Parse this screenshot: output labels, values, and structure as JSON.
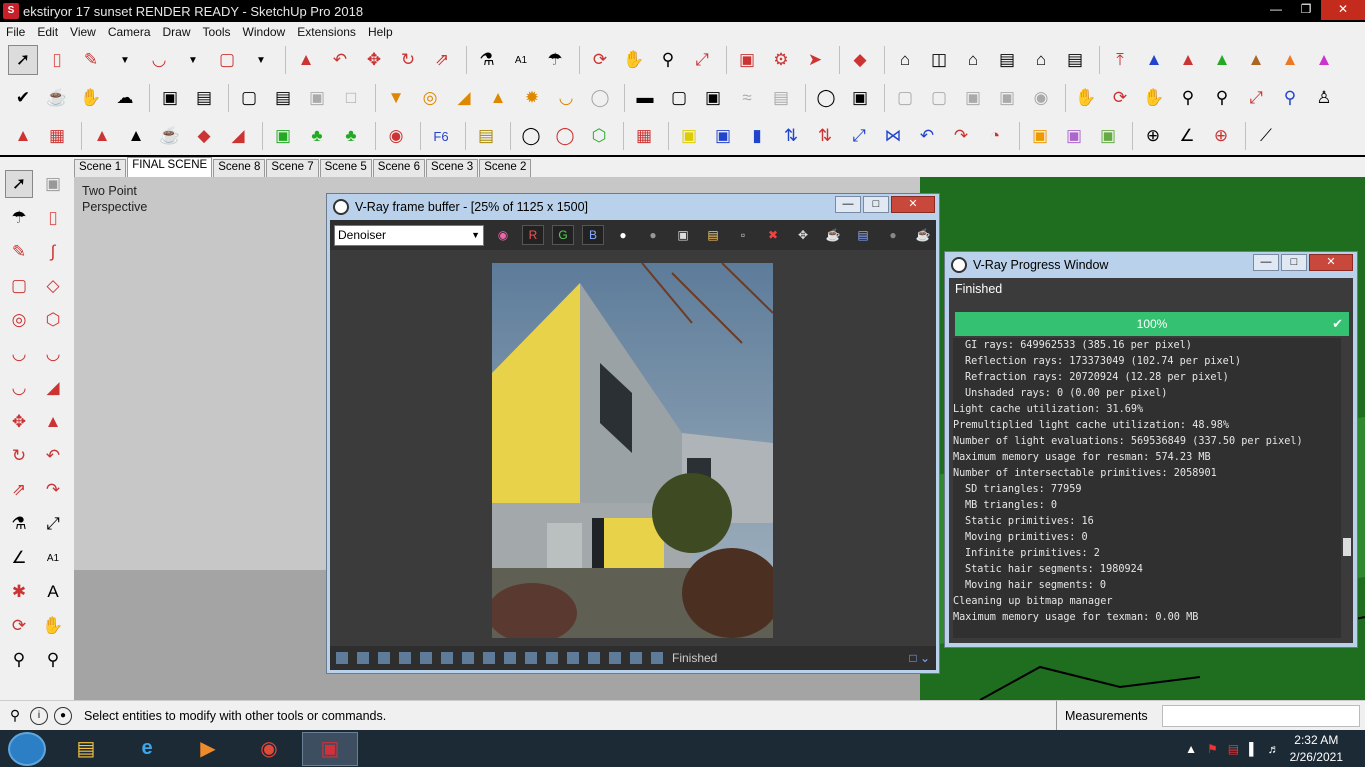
{
  "app": {
    "title": "ekstiryor 17 sunset RENDER READY - SketchUp Pro 2018"
  },
  "menu": [
    "File",
    "Edit",
    "View",
    "Camera",
    "Draw",
    "Tools",
    "Window",
    "Extensions",
    "Help"
  ],
  "scenes": [
    "Scene 1",
    "FINAL SCENE",
    "Scene 8",
    "Scene 7",
    "Scene 5",
    "Scene 6",
    "Scene 3",
    "Scene 2"
  ],
  "viewport": {
    "label_line1": "Two Point",
    "label_line2": "Perspective"
  },
  "vfb": {
    "title": "V-Ray frame buffer - [25% of 1125 x 1500]",
    "dropdown": "Denoiser",
    "r": "R",
    "g": "G",
    "b": "B",
    "status": "Finished"
  },
  "progress_window": {
    "title": "V-Ray Progress Window",
    "status": "Finished",
    "percent": "100%",
    "percent_value": 100,
    "log": [
      {
        "text": "GI rays: 649962533 (385.16 per pixel)",
        "indent": true
      },
      {
        "text": "Reflection rays: 173373049 (102.74 per pixel)",
        "indent": true
      },
      {
        "text": "Refraction rays: 20720924 (12.28 per pixel)",
        "indent": true
      },
      {
        "text": "Unshaded rays: 0 (0.00 per pixel)",
        "indent": true
      },
      {
        "text": "Light cache utilization: 31.69%",
        "indent": false
      },
      {
        "text": "Premultiplied light cache utilization: 48.98%",
        "indent": false
      },
      {
        "text": "Number of light evaluations: 569536849 (337.50 per pixel)",
        "indent": false
      },
      {
        "text": "Maximum memory usage for resman: 574.23 MB",
        "indent": false
      },
      {
        "text": "Number of intersectable primitives: 2058901",
        "indent": false
      },
      {
        "text": "SD triangles: 77959",
        "indent": true
      },
      {
        "text": "MB triangles: 0",
        "indent": true
      },
      {
        "text": "Static primitives: 16",
        "indent": true
      },
      {
        "text": "Moving primitives: 0",
        "indent": true
      },
      {
        "text": "Infinite primitives: 2",
        "indent": true
      },
      {
        "text": "Static hair segments: 1980924",
        "indent": true
      },
      {
        "text": "Moving hair segments: 0",
        "indent": true
      },
      {
        "text": "Cleaning up bitmap manager",
        "indent": false
      },
      {
        "text": "Maximum memory usage for texman: 0.00 MB",
        "indent": false
      }
    ]
  },
  "statusbar": {
    "message": "Select entities to modify with other tools or commands.",
    "measurements_label": "Measurements"
  },
  "clock": {
    "time": "2:32 AM",
    "date": "2/26/2021"
  },
  "colors": {
    "progress": "#34c272",
    "vray_bg": "#3b3b3b",
    "window_frame": "#b9d1ea"
  }
}
